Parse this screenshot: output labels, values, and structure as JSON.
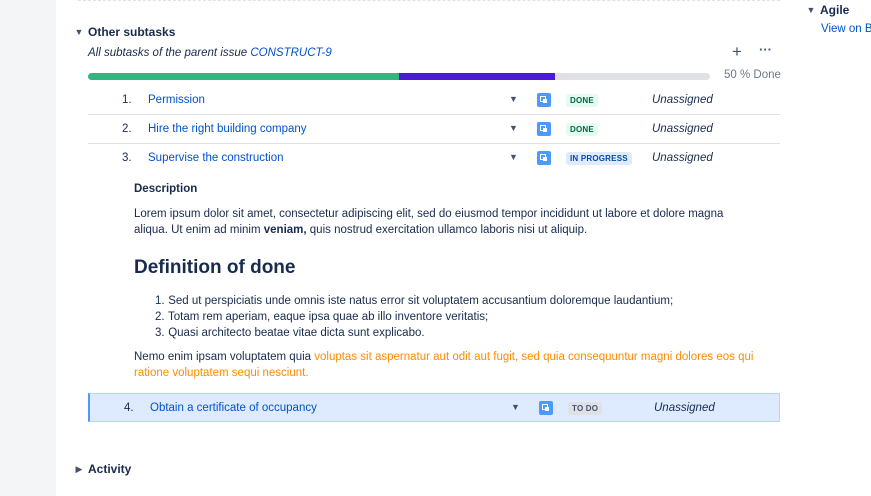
{
  "other_subtasks": {
    "title": "Other subtasks",
    "subtitle_prefix": "All subtasks of the parent issue ",
    "parent_issue": "CONSTRUCT-9",
    "add_icon": "plus-icon",
    "more_icon": "more-icon",
    "progress": {
      "done_fraction": 0.5,
      "in_progress_fraction": 0.25,
      "label": "50 % Done",
      "colors": {
        "done": "#36B37E",
        "in_progress": "#4A1BD8",
        "todo": "#DFE1E6"
      }
    },
    "subtasks": [
      {
        "num": "1.",
        "summary": "Permission",
        "status": "DONE",
        "assignee": "Unassigned"
      },
      {
        "num": "2.",
        "summary": "Hire the right building company",
        "status": "DONE",
        "assignee": "Unassigned"
      },
      {
        "num": "3.",
        "summary": "Supervise the construction",
        "status": "IN PROGRESS",
        "assignee": "Unassigned"
      },
      {
        "num": "4.",
        "summary": "Obtain a certificate of occupancy",
        "status": "TO DO",
        "assignee": "Unassigned"
      }
    ],
    "expanded_detail": {
      "description_heading": "Description",
      "description_before_bold": "Lorem ipsum dolor sit amet, consectetur adipiscing elit, sed do eiusmod tempor incididunt ut labore et dolore magna aliqua. Ut enim ad minim ",
      "description_bold": "veniam,",
      "description_after_bold": " quis nostrud exercitation ullamco laboris nisi ut aliquip.",
      "dod_heading": "Definition of done",
      "dod_items": [
        {
          "n": "1.",
          "text": "Sed ut perspiciatis unde omnis iste natus error sit voluptatem accusantium doloremque laudantium;"
        },
        {
          "n": "2.",
          "text": "Totam rem aperiam, eaque ipsa quae ab illo inventore veritatis;"
        },
        {
          "n": "3.",
          "text": "Quasi architecto beatae vitae dicta sunt explicabo."
        }
      ],
      "nemo_plain": "Nemo enim ipsam voluptatem quia ",
      "nemo_orange": "voluptas sit aspernatur aut odit aut fugit, sed quia consequuntur magni dolores eos qui ratione voluptatem sequi nesciunt.",
      "accent_orange": "#FF8B00"
    }
  },
  "activity": {
    "title": "Activity"
  },
  "agile": {
    "title": "Agile",
    "link": "View on B"
  }
}
